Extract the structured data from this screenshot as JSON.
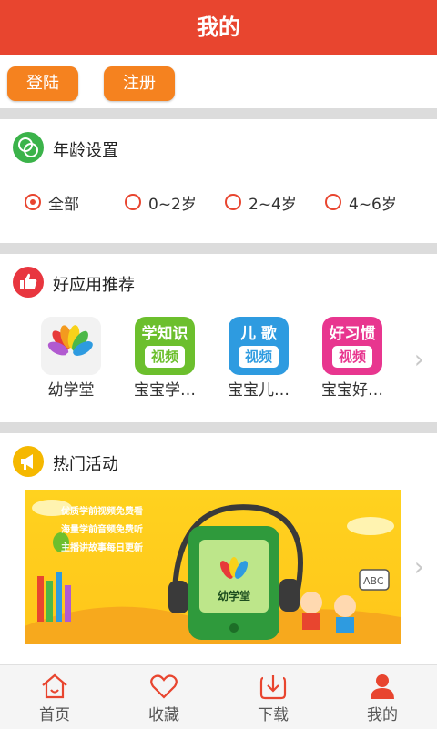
{
  "header": {
    "title": "我的"
  },
  "auth": {
    "login_label": "登陆",
    "register_label": "注册"
  },
  "age_section": {
    "title": "年龄设置",
    "icon": "faces-icon",
    "options": [
      {
        "label": "全部",
        "selected": true
      },
      {
        "label": "0~2岁",
        "selected": false
      },
      {
        "label": "2~4岁",
        "selected": false
      },
      {
        "label": "4~6岁",
        "selected": false
      }
    ]
  },
  "apps_section": {
    "title": "好应用推荐",
    "icon": "thumbs-up-icon",
    "apps": [
      {
        "name": "幼学堂",
        "icon": "youxuetang-logo"
      },
      {
        "name": "宝宝学…",
        "icon_line1": "学知识",
        "icon_line2": "视频",
        "icon_color": "#6cbf2d"
      },
      {
        "name": "宝宝儿…",
        "icon_line1": "儿 歌",
        "icon_line2": "视频",
        "icon_color": "#2e9be0"
      },
      {
        "name": "宝宝好…",
        "icon_line1": "好习惯",
        "icon_line2": "视频",
        "icon_color": "#e8368f"
      }
    ]
  },
  "activity_section": {
    "title": "热门活动",
    "icon": "megaphone-icon",
    "banner": {
      "bullets": [
        "优质学前视频免费看",
        "海量学前音频免费听",
        "主播讲故事每日更新"
      ],
      "screen_label": "幼学堂"
    }
  },
  "tabbar": {
    "tabs": [
      {
        "label": "首页",
        "icon": "home-icon"
      },
      {
        "label": "收藏",
        "icon": "heart-icon"
      },
      {
        "label": "下载",
        "icon": "download-icon"
      },
      {
        "label": "我的",
        "icon": "person-icon",
        "active": true
      }
    ]
  },
  "colors": {
    "primary": "#e8452f",
    "button": "#f5821f"
  }
}
